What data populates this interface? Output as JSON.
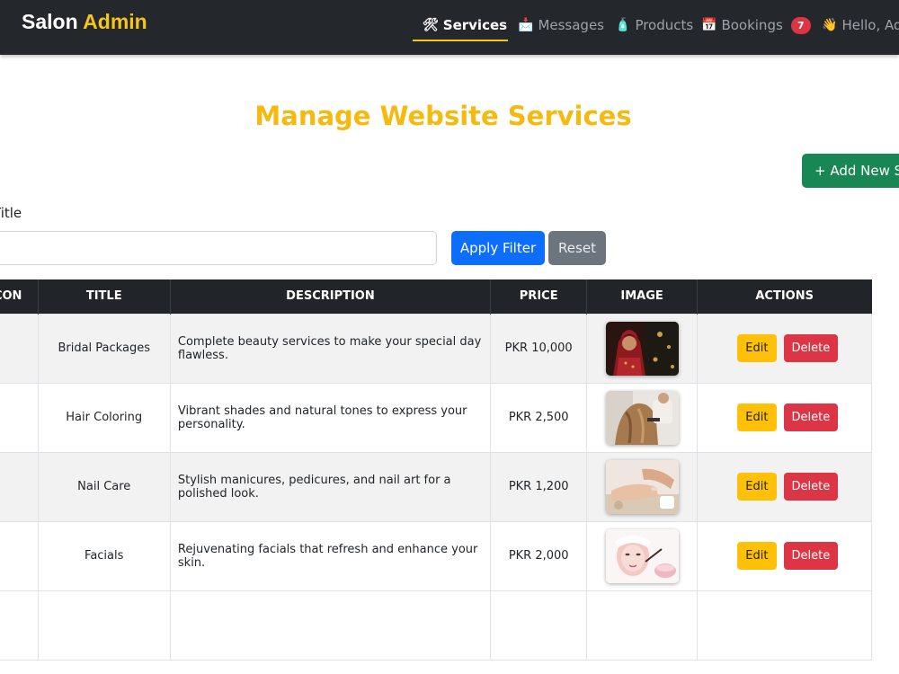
{
  "brand": {
    "part1": "Salon",
    "part2": "Admin"
  },
  "nav": {
    "services": {
      "icon": "🛠",
      "label": "Services"
    },
    "messages": {
      "icon": "📩",
      "label": "Messages"
    },
    "products": {
      "icon": "🧴",
      "label": "Products"
    },
    "bookings": {
      "icon": "📅",
      "label": "Bookings",
      "badge": "7"
    },
    "hello": {
      "icon": "👋",
      "label": "Hello, Ad"
    }
  },
  "page": {
    "title": "Manage Website Services",
    "add_button": "+ Add New Se"
  },
  "filter": {
    "label": "Title",
    "input_value": "",
    "apply_label": "Apply Filter",
    "reset_label": "Reset"
  },
  "table": {
    "headers": {
      "icon": "ICON",
      "title": "TITLE",
      "description": "DESCRIPTION",
      "price": "PRICE",
      "image": "IMAGE",
      "actions": "ACTIONS"
    },
    "rows": [
      {
        "title": "Bridal Packages",
        "description": "Complete beauty services to make your special day flawless.",
        "price": "PKR 10,000",
        "image": "bridal-photo",
        "edit": "Edit",
        "delete": "Delete"
      },
      {
        "title": "Hair Coloring",
        "description": "Vibrant shades and natural tones to express your personality.",
        "price": "PKR 2,500",
        "image": "hair-coloring-photo",
        "edit": "Edit",
        "delete": "Delete"
      },
      {
        "title": "Nail Care",
        "description": "Stylish manicures, pedicures, and nail art for a polished look.",
        "price": "PKR 1,200",
        "image": "nail-care-photo",
        "edit": "Edit",
        "delete": "Delete"
      },
      {
        "title": "Facials",
        "description": "Rejuvenating facials that refresh and enhance your skin.",
        "price": "PKR 2,000",
        "image": "facial-photo",
        "edit": "Edit",
        "delete": "Delete"
      }
    ]
  },
  "colors": {
    "navbar": "#24272b",
    "accent": "#f5c518",
    "success": "#198754",
    "primary": "#0d6efd",
    "secondary": "#6c757d",
    "warning": "#ffc107",
    "danger": "#dc3545"
  }
}
